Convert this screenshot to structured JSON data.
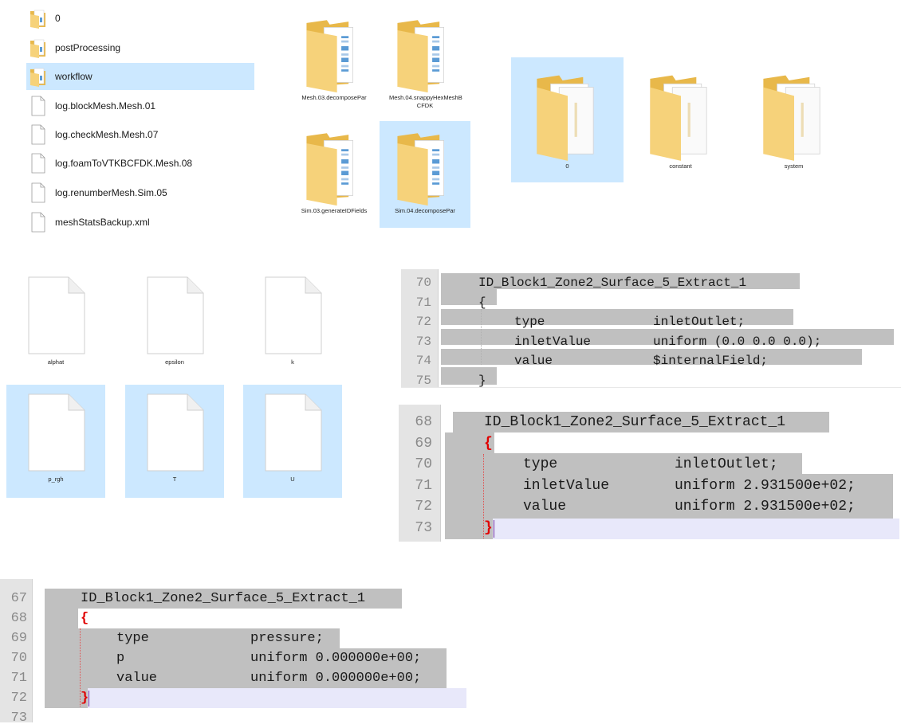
{
  "list_view": {
    "items": [
      {
        "label": "0",
        "type": "folder"
      },
      {
        "label": "postProcessing",
        "type": "folder"
      },
      {
        "label": "workflow",
        "type": "folder",
        "selected": true
      },
      {
        "label": "log.blockMesh.Mesh.01",
        "type": "file"
      },
      {
        "label": "log.checkMesh.Mesh.07",
        "type": "file"
      },
      {
        "label": "log.foamToVTKBCFDK.Mesh.08",
        "type": "file"
      },
      {
        "label": "log.renumberMesh.Sim.05",
        "type": "file"
      },
      {
        "label": "meshStatsBackup.xml",
        "type": "file"
      }
    ]
  },
  "workflow_tiles": [
    {
      "label": "Mesh.03.decomposePar"
    },
    {
      "label": "Mesh.04.snappyHexMeshB CFDK"
    },
    {
      "label": "Sim.03.generateIDFields"
    },
    {
      "label": "Sim.04.decomposePar",
      "selected": true
    }
  ],
  "case_tiles": [
    {
      "label": "0",
      "selected": true
    },
    {
      "label": "constant"
    },
    {
      "label": "system"
    }
  ],
  "field_files": [
    {
      "label": "alphat"
    },
    {
      "label": "epsilon"
    },
    {
      "label": "k"
    },
    {
      "label": "p_rgh",
      "selected": true
    },
    {
      "label": "T",
      "selected": true
    },
    {
      "label": "U",
      "selected": true
    }
  ],
  "editor_u": {
    "lines": [
      {
        "num": "70",
        "text": "ID_Block1_Zone2_Surface_5_Extract_1"
      },
      {
        "num": "71",
        "text": "{"
      },
      {
        "num": "72",
        "key": "type",
        "val": "inletOutlet;"
      },
      {
        "num": "73",
        "key": "inletValue",
        "val": "uniform (0.0 0.0 0.0);"
      },
      {
        "num": "74",
        "key": "value",
        "val": "$internalField;"
      },
      {
        "num": "75",
        "text": "}"
      }
    ]
  },
  "editor_t": {
    "lines": [
      {
        "num": "68",
        "text": "ID_Block1_Zone2_Surface_5_Extract_1"
      },
      {
        "num": "69",
        "text": "{"
      },
      {
        "num": "70",
        "key": "type",
        "val": "inletOutlet;"
      },
      {
        "num": "71",
        "key": "inletValue",
        "val": "uniform 2.931500e+02;"
      },
      {
        "num": "72",
        "key": "value",
        "val": "uniform 2.931500e+02;"
      },
      {
        "num": "73",
        "text": "}"
      }
    ]
  },
  "editor_p": {
    "lines": [
      {
        "num": "67",
        "text": "ID_Block1_Zone2_Surface_5_Extract_1"
      },
      {
        "num": "68",
        "text": "{"
      },
      {
        "num": "69",
        "key": "type",
        "val": "pressure;"
      },
      {
        "num": "70",
        "key": "p",
        "val": "uniform 0.000000e+00;"
      },
      {
        "num": "71",
        "key": "value",
        "val": "uniform 0.000000e+00;"
      },
      {
        "num": "72",
        "text": "}"
      },
      {
        "num": "73",
        "text": ""
      }
    ]
  },
  "colors": {
    "selection": "#cce8ff",
    "line_highlight": "#c0c0c0",
    "brace": "#e00000",
    "folder": "#f2cc6a"
  }
}
